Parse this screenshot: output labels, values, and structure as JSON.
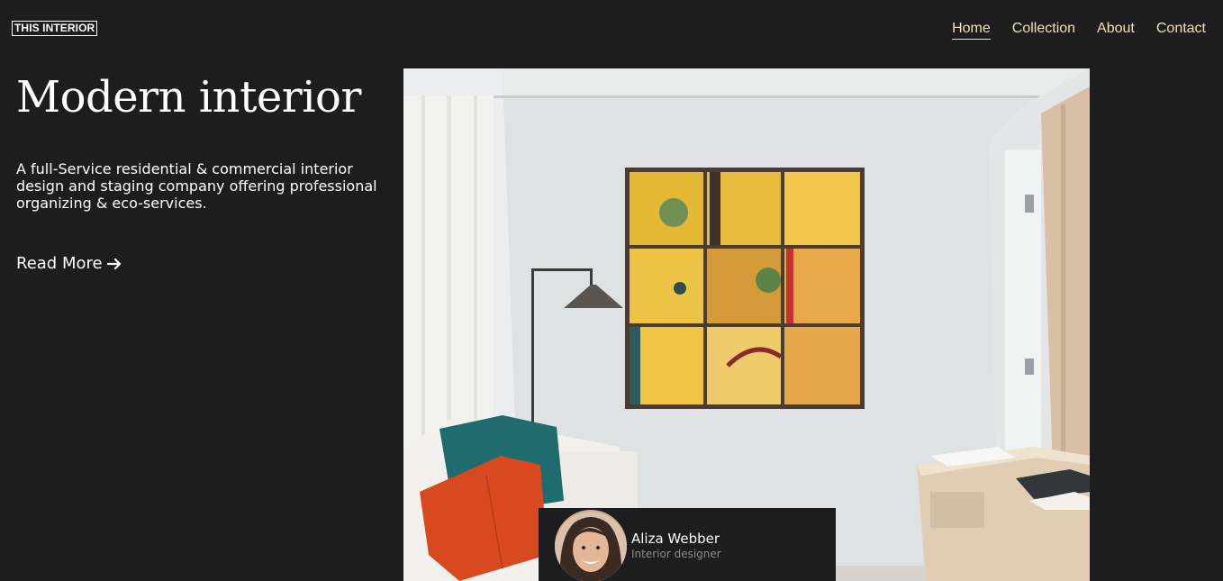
{
  "logo": {
    "text": "THIS INTERIOR"
  },
  "nav": {
    "items": [
      {
        "label": "Home",
        "active": true
      },
      {
        "label": "Collection"
      },
      {
        "label": "About"
      },
      {
        "label": "Contact"
      }
    ]
  },
  "hero": {
    "title": "Modern interior",
    "description": "A full-Service residential & commercial interior design and staging company offering professional organizing & eco-services.",
    "cta_label": "Read More"
  },
  "designer": {
    "name": "Aliza Webber",
    "role": "Interior designer"
  },
  "colors": {
    "background": "#1d1d1d",
    "nav_text": "#f0e0b8",
    "text": "#ffffff",
    "muted": "#8a8a8a"
  },
  "icons": {
    "cta": "arrow-right-icon"
  }
}
